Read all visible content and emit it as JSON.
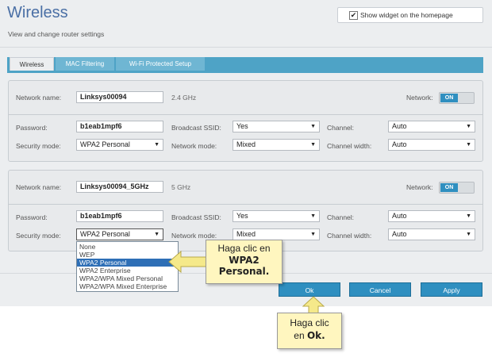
{
  "header": {
    "title": "Wireless",
    "subtitle": "View and change router settings",
    "widget_checkbox_label": "Show widget on the homepage",
    "widget_checked": true
  },
  "tabs": [
    {
      "label": "Wireless",
      "active": true
    },
    {
      "label": "MAC Filtering",
      "active": false
    },
    {
      "label": "Wi-Fi Protected Setup",
      "active": false
    }
  ],
  "band24": {
    "network_name_label": "Network name:",
    "network_name_value": "Linksys00094",
    "band_label": "2.4 GHz",
    "network_label": "Network:",
    "network_toggle": "ON",
    "password_label": "Password:",
    "password_value": "b1eab1mpf6",
    "broadcast_ssid_label": "Broadcast SSID:",
    "broadcast_ssid_value": "Yes",
    "channel_label": "Channel:",
    "channel_value": "Auto",
    "security_mode_label": "Security mode:",
    "security_mode_value": "WPA2 Personal",
    "network_mode_label": "Network mode:",
    "network_mode_value": "Mixed",
    "channel_width_label": "Channel width:",
    "channel_width_value": "Auto"
  },
  "band5": {
    "network_name_label": "Network name:",
    "network_name_value": "Linksys00094_5GHz",
    "band_label": "5 GHz",
    "network_label": "Network:",
    "network_toggle": "ON",
    "password_label": "Password:",
    "password_value": "b1eab1mpf6",
    "broadcast_ssid_label": "Broadcast SSID:",
    "broadcast_ssid_value": "Yes",
    "channel_label": "Channel:",
    "channel_value": "Auto",
    "security_mode_label": "Security mode:",
    "security_mode_value": "WPA2 Personal",
    "network_mode_label": "Network mode:",
    "network_mode_value": "Mixed",
    "channel_width_label": "Channel width:",
    "channel_width_value": "Auto"
  },
  "security_dropdown": {
    "options": [
      "None",
      "WEP",
      "WPA2 Personal",
      "WPA2 Enterprise",
      "WPA2/WPA Mixed Personal",
      "WPA2/WPA Mixed Enterprise"
    ],
    "highlighted": "WPA2 Personal"
  },
  "buttons": {
    "ok": "Ok",
    "cancel": "Cancel",
    "apply": "Apply"
  },
  "callouts": {
    "select_line1": "Haga clic en",
    "select_line2": "WPA2",
    "select_line3": "Personal.",
    "ok_line1": "Haga clic",
    "ok_line2_prefix": "en ",
    "ok_line2_bold": "Ok."
  },
  "colors": {
    "accent": "#2f8fc0",
    "tab_bar": "#4ea3c6",
    "title": "#4a6fa5",
    "callout_bg": "#fff6bf",
    "arrow": "#f5e98a"
  }
}
